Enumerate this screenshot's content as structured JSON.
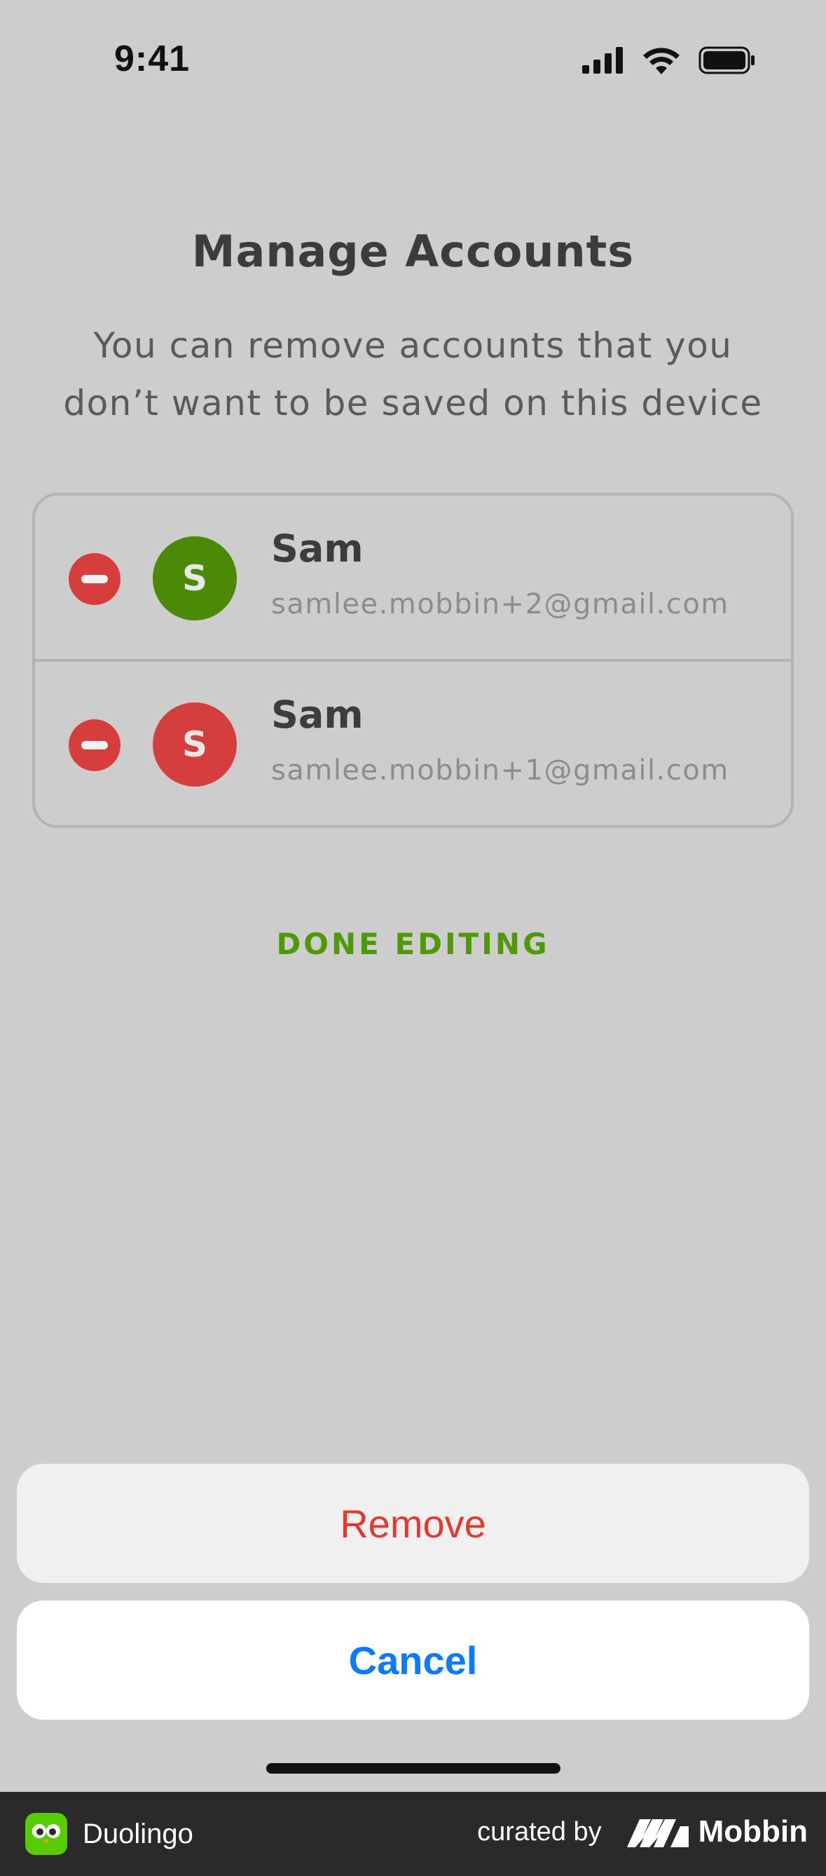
{
  "status_bar": {
    "time": "9:41",
    "icons": [
      "cellular-signal-icon",
      "wifi-icon",
      "battery-icon"
    ]
  },
  "header": {
    "title": "Manage Accounts",
    "subtitle": "You can remove accounts that you don’t want to be saved on this device"
  },
  "accounts": [
    {
      "name": "Sam",
      "email": "samlee.mobbin+2@gmail.com",
      "initial": "S",
      "avatar_color": "#4b8a07"
    },
    {
      "name": "Sam",
      "email": "samlee.mobbin+1@gmail.com",
      "initial": "S",
      "avatar_color": "#d63d3d"
    }
  ],
  "done_editing_label": "DONE EDITING",
  "action_sheet": {
    "remove_label": "Remove",
    "cancel_label": "Cancel"
  },
  "footer": {
    "app_name": "Duolingo",
    "curated_by": "curated by",
    "brand": "Mobbin"
  },
  "colors": {
    "background": "#cdcdcd",
    "accent_green": "#4e9a06",
    "destructive_red": "#e5392f",
    "ios_blue": "#0a7aff"
  }
}
